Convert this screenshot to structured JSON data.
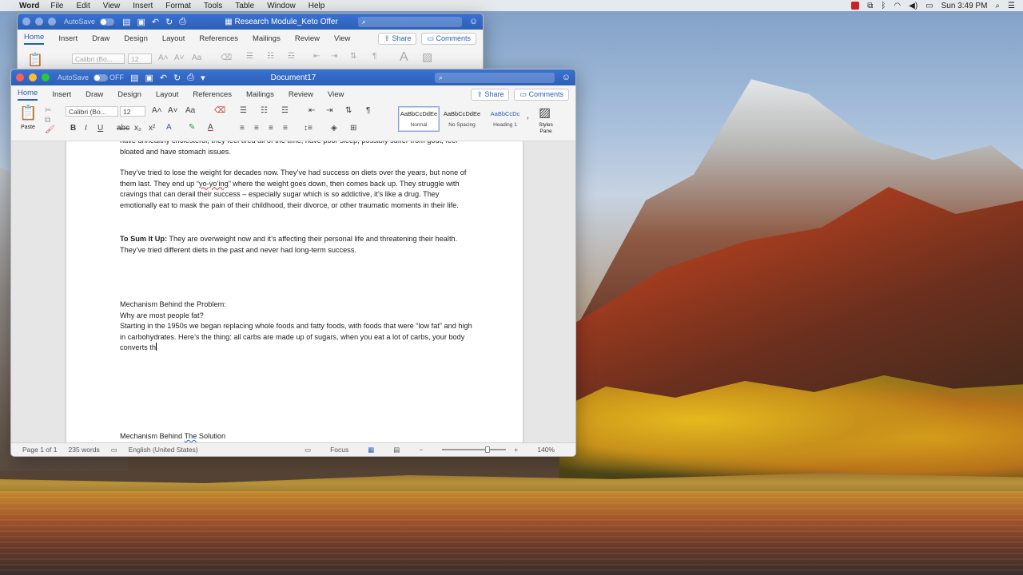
{
  "menubar": {
    "app": "Word",
    "items": [
      "File",
      "Edit",
      "View",
      "Insert",
      "Format",
      "Tools",
      "Table",
      "Window",
      "Help"
    ],
    "clock": "Sun 3:49 PM"
  },
  "back_window": {
    "title": "Research Module_Keto Offer",
    "autosave": "AutoSave",
    "tabs": [
      "Home",
      "Insert",
      "Draw",
      "Design",
      "Layout",
      "References",
      "Mailings",
      "Review",
      "View"
    ],
    "share": "Share",
    "comments": "Comments",
    "font": "Calibri (Bo...",
    "size": "12"
  },
  "front_window": {
    "title": "Document17",
    "autosave": "AutoSave",
    "autosave_state": "OFF",
    "tabs": [
      "Home",
      "Insert",
      "Draw",
      "Design",
      "Layout",
      "References",
      "Mailings",
      "Review",
      "View"
    ],
    "share": "Share",
    "comments": "Comments",
    "font": "Calibri (Bo...",
    "size": "12",
    "paste": "Paste",
    "styles": [
      {
        "preview": "AaBbCcDdEe",
        "name": "Normal"
      },
      {
        "preview": "AaBbCcDdEe",
        "name": "No Spacing"
      },
      {
        "preview": "AaBbCcDc",
        "name": "Heading 1"
      }
    ],
    "styles_pane": "Styles Pane"
  },
  "document": {
    "p0": "have unhealthy cholesterol, they feel tired all of the time, have poor sleep, possibly suffer from gout, feel bloated and have stomach issues.",
    "p1_a": "They’ve tried to lose the weight for decades now. They’ve had success on diets over the years, but none of them last. They end up “",
    "p1_squig": "yo-yo’ing",
    "p1_b": "” where the weight goes down, then comes back up. They struggle with cravings that can derail their success – especially sugar which is so addictive, it’s like a drug. They emotionally eat to mask the pain of their childhood, their divorce, or other traumatic moments in their life.",
    "p2_bold": "To Sum It Up:",
    "p2_rest": " They are overweight now and it’s affecting their personal life and threatening their health. They’ve tried different diets in the past and never had long-term success.",
    "h1": "Mechanism Behind the Problem:",
    "q1": "Why are most people fat?",
    "p3": "Starting in the 1950s we began replacing whole foods and fatty foods, with foods that were “low fat” and high in carbohydrates. Here’s the thing: all carbs are made up of sugars, when you eat a lot of carbs, your body converts th",
    "h2_a": "Mechanism Behind ",
    "h2_squig": "The",
    "h2_b": " Solution"
  },
  "statusbar": {
    "page": "Page 1 of 1",
    "words": "235 words",
    "language": "English (United States)",
    "focus": "Focus",
    "zoom": "140%"
  }
}
